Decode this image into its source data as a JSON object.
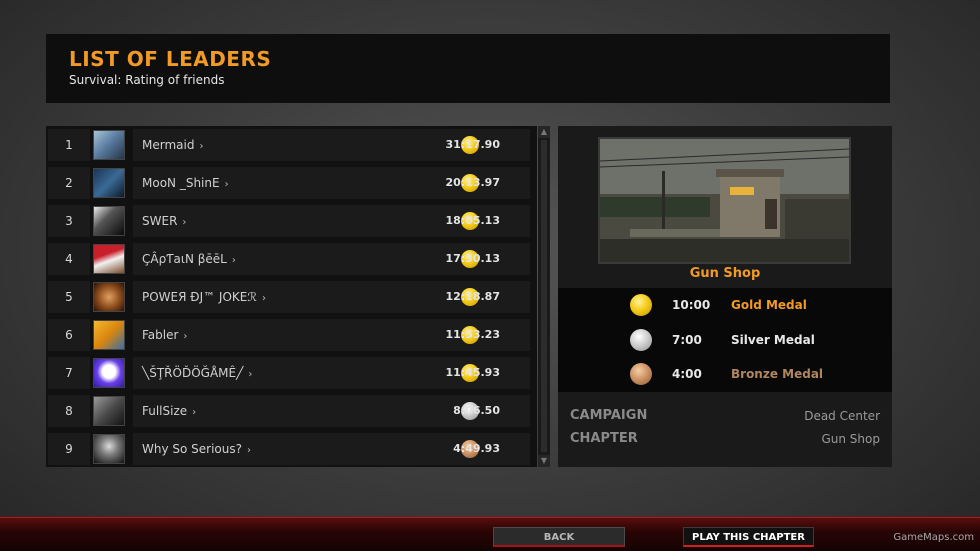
{
  "header": {
    "title": "LIST OF LEADERS",
    "subtitle": "Survival: Rating of friends"
  },
  "leaderboard": {
    "rows": [
      {
        "rank": "1",
        "name": "Mermaid",
        "medal": "gold",
        "time": "31:17.90"
      },
      {
        "rank": "2",
        "name": "MooN _ShinE",
        "medal": "gold",
        "time": "20:13.97"
      },
      {
        "rank": "3",
        "name": "SWER",
        "medal": "gold",
        "time": "18:05.13"
      },
      {
        "rank": "4",
        "name": "ÇÂρƬaιN βēēL",
        "medal": "gold",
        "time": "17:30.13"
      },
      {
        "rank": "5",
        "name": "POWEЯ ÐJ™ JOKEℛ",
        "medal": "gold",
        "time": "12:18.87"
      },
      {
        "rank": "6",
        "name": "Fabler",
        "medal": "gold",
        "time": "11:53.23"
      },
      {
        "rank": "7",
        "name": "╲ŠŢŘÖĎÖĞÅMÊ╱",
        "medal": "gold",
        "time": "11:45.93"
      },
      {
        "rank": "8",
        "name": "FullSize",
        "medal": "silver",
        "time": "8:06.50"
      },
      {
        "rank": "9",
        "name": "Why So Serious?",
        "medal": "bronze",
        "time": "4:49.93"
      }
    ],
    "chevron": "›"
  },
  "chapter": {
    "name": "Gun Shop",
    "medals": [
      {
        "medal": "gold",
        "time": "10:00",
        "label": "Gold Medal",
        "color": "#f19b26"
      },
      {
        "medal": "silver",
        "time": "7:00",
        "label": "Silver Medal",
        "color": "#e8e8e8"
      },
      {
        "medal": "bronze",
        "time": "4:00",
        "label": "Bronze Medal",
        "color": "#b08660"
      }
    ],
    "campaign_label": "CAMPAIGN",
    "campaign_value": "Dead Center",
    "chapter_label": "CHAPTER",
    "chapter_value": "Gun Shop"
  },
  "footer": {
    "back_label": "BACK",
    "play_label": "PLAY THIS CHAPTER",
    "watermark": "GameMaps.com"
  },
  "colors": {
    "accent": "#f19b26",
    "footer_red": "#b4161b"
  }
}
